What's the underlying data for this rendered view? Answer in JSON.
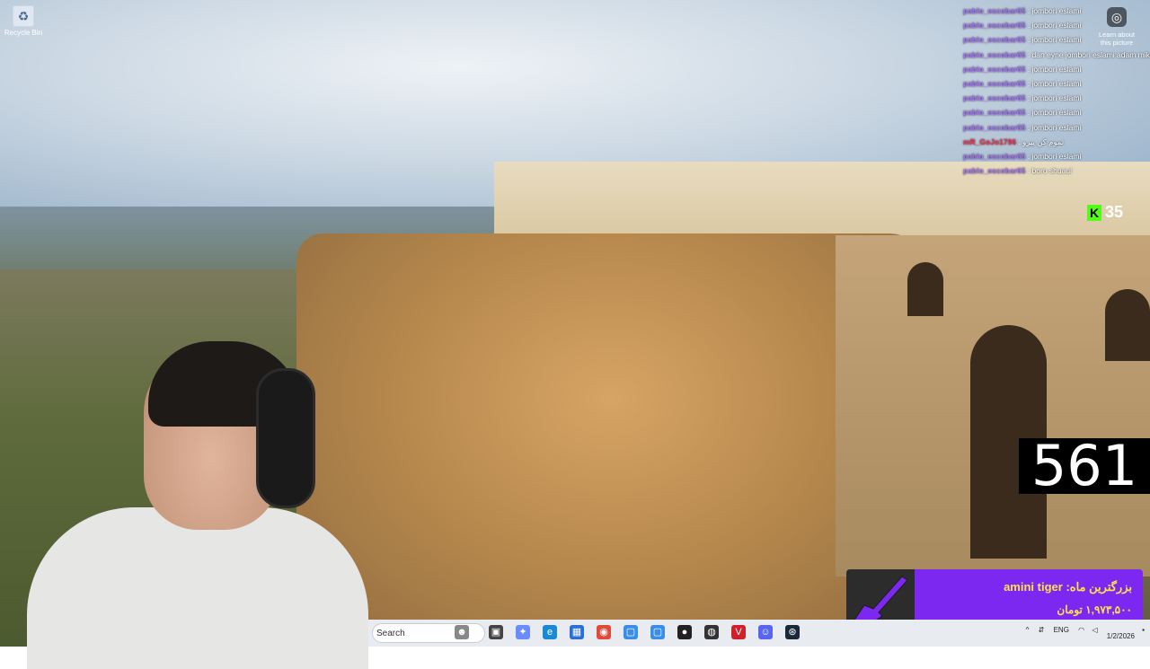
{
  "desktop": {
    "recycle_bin_label": "Recycle Bin"
  },
  "wallpaper": {
    "learn_label": "Learn about this picture"
  },
  "chat": {
    "messages": [
      {
        "user": "pablo_escobar65",
        "text": "jombori eslami",
        "color": "#a974ff"
      },
      {
        "user": "pablo_escobar65",
        "text": "jombori eslami",
        "color": "#a974ff"
      },
      {
        "user": "pablo_escobar65",
        "text": "jombori eslami",
        "color": "#a974ff"
      },
      {
        "user": "pablo_escobar65",
        "text": "dan eyne jombori eslami adam mikoshi",
        "color": "#a974ff"
      },
      {
        "user": "pablo_escobar65",
        "text": "jombori eslami",
        "color": "#a974ff"
      },
      {
        "user": "pablo_escobar65",
        "text": "jombori eslami",
        "color": "#a974ff"
      },
      {
        "user": "pablo_escobar65",
        "text": "jombori eslami",
        "color": "#a974ff"
      },
      {
        "user": "pablo_escobar65",
        "text": "jombori eslami",
        "color": "#a974ff"
      },
      {
        "user": "pablo_escobar65",
        "text": "jombori eslami",
        "color": "#a974ff"
      },
      {
        "user": "mR_GoJo1796",
        "text": "تموم کن پیرو",
        "color": "#ff3050"
      },
      {
        "user": "pablo_escobar65",
        "text": "jombori eslami",
        "color": "#a974ff"
      },
      {
        "user": "pablo_escobar65",
        "text": "boro shuaul",
        "color": "#a974ff"
      }
    ]
  },
  "kick": {
    "viewer_count": "35",
    "brand_color": "#53fc18"
  },
  "counter": {
    "value": "561"
  },
  "donation": {
    "top_label": "بزرگترین ماه:",
    "name": "amini tiger",
    "amount": "۱,۹۷۳,۵۰۰ تومان",
    "bg_color": "#7c28f0",
    "text_color": "#ffe14a"
  },
  "taskbar": {
    "search_placeholder": "Search",
    "language": "ENG",
    "date": "1/2/2026"
  }
}
